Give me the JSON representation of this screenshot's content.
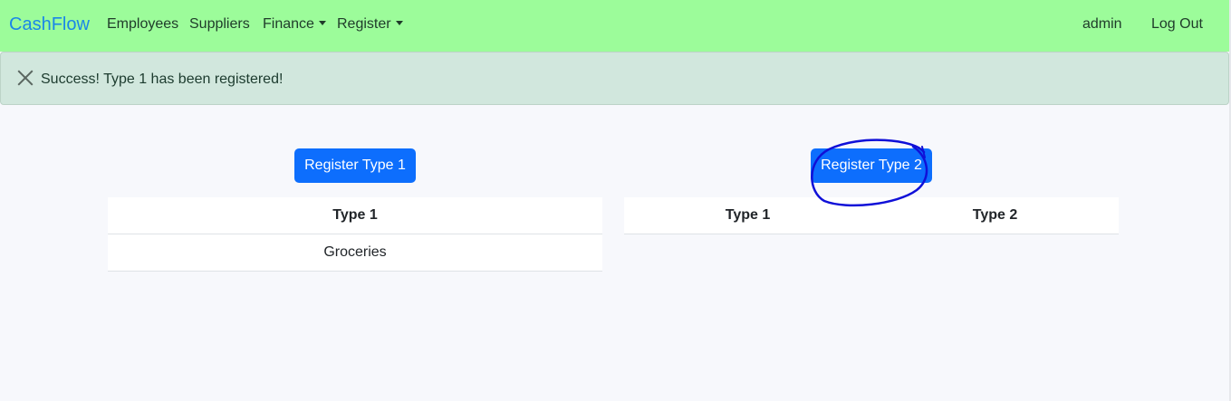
{
  "navbar": {
    "brand": "CashFlow",
    "links": [
      "Employees",
      "Suppliers",
      "Finance",
      "Register"
    ],
    "user": "admin",
    "logout": "Log Out"
  },
  "alert": {
    "message": "Success! Type 1 has been registered!"
  },
  "left": {
    "button": "Register Type 1",
    "headers": [
      "Type 1"
    ],
    "rows": [
      [
        "Groceries"
      ]
    ]
  },
  "right": {
    "button": "Register Type 2",
    "headers": [
      "Type 1",
      "Type 2"
    ],
    "rows": []
  },
  "colors": {
    "navbar": "#9cfc9a",
    "primary": "#0d6efd",
    "alert": "#d1e7dd",
    "annotation": "#1010d8"
  }
}
